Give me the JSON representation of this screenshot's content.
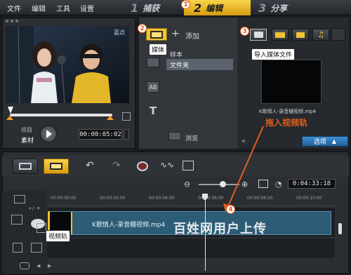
{
  "menu": [
    "文件",
    "编辑",
    "工具",
    "设置"
  ],
  "steps": [
    {
      "num": "1",
      "label": "捕获"
    },
    {
      "num": "2",
      "label": "编辑"
    },
    {
      "num": "3",
      "label": "分享"
    }
  ],
  "annotations": {
    "badges": [
      "1",
      "2",
      "3",
      "4"
    ],
    "media_tooltip": "媒体",
    "import_tooltip": "导入媒体文件",
    "drag_hint": "拖入视频轨",
    "video_track_tooltip": "视频轨"
  },
  "preview": {
    "mode_label": "项目",
    "mode_value": "素材",
    "timecode": "00:00:05:02",
    "video_logo": "蓝点"
  },
  "library": {
    "add_label": "添加",
    "folders": [
      "样本",
      "文件夹"
    ],
    "browse_label": "浏览",
    "clip_name": "K歌情人-录音棚视频.mp4",
    "options_label": "选项"
  },
  "timeline": {
    "zoom_timecode": "0:04:33:18",
    "ruler": [
      "00:00:00:00",
      "00:00:02:00",
      "00:00:04:00",
      "00:00:06:00",
      "00:00:08:00",
      "00:00:10:00"
    ],
    "clip_name": "K歌情人-录音棚视频.mp4"
  },
  "watermark": "百姓网用户上传",
  "colors": {
    "accent": "#f5c02a",
    "annotation": "#e25d1b",
    "clip": "#2d5c76"
  }
}
